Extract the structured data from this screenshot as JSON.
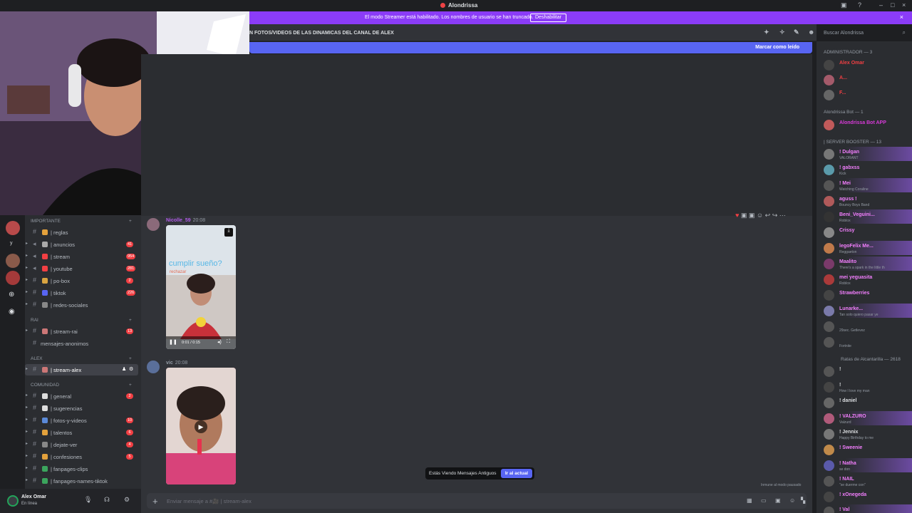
{
  "app": {
    "title": "Alondrissa"
  },
  "banner": {
    "text": "El modo Streamer está habilitado. Los nombres de usuario se han truncado.",
    "button": "Deshabilitar"
  },
  "channel": {
    "topic": "N FOTOS/VIDEOS DE LAS DINAMICAS DEL CANAL DE ALEX"
  },
  "search": {
    "placeholder": "Buscar Alondrissa"
  },
  "newbar": {
    "label": "Marcar como leído"
  },
  "messages": [
    {
      "author": "Nicolle_59",
      "time": "20:08",
      "caption": "cumplir sueño?",
      "subcaption": "rechazar",
      "video_time": "0:01 / 0:15",
      "author_color": "#b05ce8"
    },
    {
      "author": "vic",
      "time": "20:08",
      "author_color": "#949ba4"
    }
  ],
  "old_messages": {
    "text": "Estás Viendo Mensajes Antiguos",
    "button": "Ir al actual"
  },
  "composer": {
    "placeholder": "Enviar mensaje a #🎥 | stream-alex"
  },
  "sidebar": {
    "categories": [
      {
        "name": "IMPORTANTE",
        "channels": [
          {
            "label": "| reglas",
            "badge": ""
          },
          {
            "label": "| anuncios",
            "badge": "41"
          },
          {
            "label": "| stream",
            "badge": "954"
          },
          {
            "label": "| youtube",
            "badge": "281"
          },
          {
            "label": "| po-box",
            "badge": "2"
          },
          {
            "label": "| tiktok",
            "badge": "226"
          },
          {
            "label": "| redes-sociales",
            "badge": ""
          }
        ]
      },
      {
        "name": "RAI",
        "channels": [
          {
            "label": "| stream-rai",
            "badge": "13"
          },
          {
            "label": "mensajes-anonimos",
            "badge": ""
          }
        ]
      },
      {
        "name": "ALEX",
        "channels": [
          {
            "label": "| stream-alex",
            "badge": "",
            "active": true
          }
        ]
      },
      {
        "name": "COMUNIDAD",
        "channels": [
          {
            "label": "| general",
            "badge": "2"
          },
          {
            "label": "| sugerencias",
            "badge": ""
          },
          {
            "label": "| fotos-y-videos",
            "badge": "10"
          },
          {
            "label": "| talentos",
            "badge": "6"
          },
          {
            "label": "| dejate-ver",
            "badge": "4"
          },
          {
            "label": "| confesiones",
            "badge": "5"
          },
          {
            "label": "| fanpages-clips",
            "badge": ""
          },
          {
            "label": "| fanpages-names-tiktok",
            "badge": ""
          }
        ]
      }
    ]
  },
  "user": {
    "name": "Alex Omar",
    "status": "En línea"
  },
  "members": {
    "groups": [
      {
        "title": "ADMINISTRADOR — 3",
        "items": [
          {
            "name": "Alex Omar",
            "sub": "",
            "color": "#f23f43"
          },
          {
            "name": "A...",
            "sub": "",
            "color": "#f23f43"
          },
          {
            "name": "F...",
            "sub": "",
            "color": "#f23f43"
          }
        ]
      },
      {
        "title": "Alondrissa Bot — 1",
        "items": [
          {
            "name": "Alondrissa Bot APP",
            "sub": "",
            "color": "#d83ad8"
          }
        ]
      },
      {
        "title": "| SERVER BOOSTER — 13",
        "items": [
          {
            "name": "! Dulgan",
            "sub": "VALORANT",
            "color": "#f47fff"
          },
          {
            "name": "! gabxss",
            "sub": "Kick",
            "color": "#f47fff"
          },
          {
            "name": "! Mei",
            "sub": "Watching Coraline",
            "color": "#f47fff"
          },
          {
            "name": "aguss !",
            "sub": "Bouncy Boys Band",
            "color": "#f47fff"
          },
          {
            "name": "Beni_Veguini...",
            "sub": "Roblox",
            "color": "#f47fff"
          },
          {
            "name": "Crissy",
            "sub": "",
            "color": "#f47fff"
          },
          {
            "name": "legoFelix Me...",
            "sub": "Reggaeton",
            "color": "#f47fff"
          },
          {
            "name": "Maalito",
            "sub": "There's a spark in the little th",
            "color": "#f47fff"
          },
          {
            "name": "mei yeguasita",
            "sub": "Roblox",
            "color": "#f47fff"
          },
          {
            "name": "Strawberries",
            "sub": "",
            "color": "#f47fff"
          },
          {
            "name": "Lunarke...",
            "sub": "Tan solo quiero pasar ye",
            "color": "#f47fff"
          },
          {
            "name": "",
            "sub": "29sec. Getlevez",
            "color": "#f47fff"
          },
          {
            "name": "",
            "sub": "Fortnite",
            "color": "#f47fff"
          }
        ]
      },
      {
        "title": "Ratas de Alcantarilla — 2618",
        "items": [
          {
            "name": "!",
            "sub": "",
            "color": "#dbdee1"
          },
          {
            "name": "!",
            "sub": "How I love my man",
            "color": "#dbdee1"
          },
          {
            "name": "! daniel",
            "sub": "",
            "color": "#dbdee1"
          },
          {
            "name": "! VALZURO",
            "sub": "Valzurd",
            "color": "#dbdee1"
          },
          {
            "name": "! Jennix",
            "sub": "Happy Birthday to me",
            "color": "#dbdee1"
          },
          {
            "name": "! Sweenie",
            "sub": "",
            "color": "#dbdee1"
          },
          {
            "name": "! Natha",
            "sub": "se don",
            "color": "#dbdee1"
          },
          {
            "name": "! NAIL",
            "sub": "\"se duerme con\"",
            "color": "#dbdee1"
          },
          {
            "name": "! xOnegeda",
            "sub": "",
            "color": "#dbdee1"
          },
          {
            "name": "! Val",
            "sub": "",
            "color": "#dbdee1"
          }
        ]
      }
    ]
  },
  "footer_note": "Inmune al modo pausado"
}
